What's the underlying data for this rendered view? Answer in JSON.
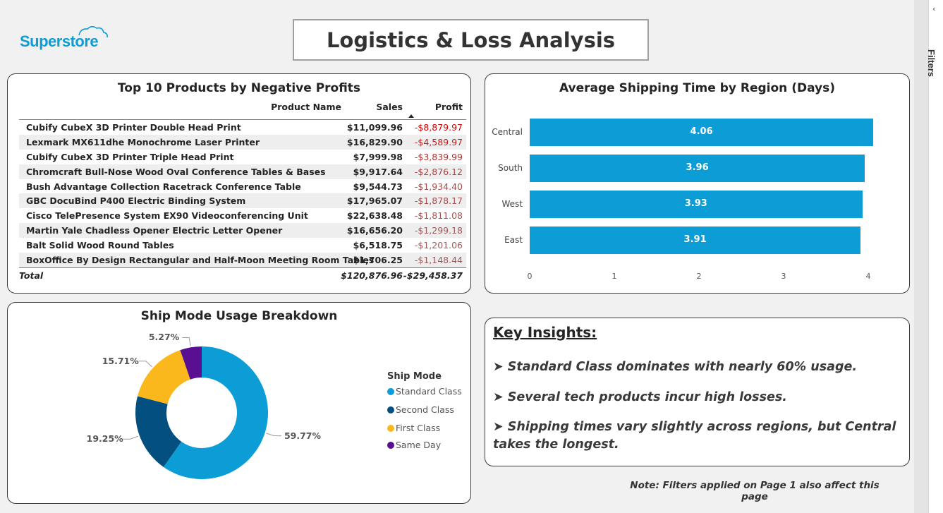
{
  "brand": {
    "logo_text": "Superstore"
  },
  "page": {
    "title": "Logistics & Loss Analysis"
  },
  "filters_pane": {
    "label": "Filters",
    "collapse_icon": "chevron-left-icon"
  },
  "products_table": {
    "title": "Top 10 Products by Negative Profits",
    "columns": [
      "Product Name",
      "Sales",
      "Profit"
    ],
    "sorted_column": "Profit",
    "rows": [
      {
        "name": "Cubify CubeX 3D Printer Double Head Print",
        "sales": "$11,099.96",
        "profit": "-$8,879.97"
      },
      {
        "name": "Lexmark MX611dhe Monochrome Laser Printer",
        "sales": "$16,829.90",
        "profit": "-$4,589.97"
      },
      {
        "name": "Cubify CubeX 3D Printer Triple Head Print",
        "sales": "$7,999.98",
        "profit": "-$3,839.99"
      },
      {
        "name": "Chromcraft Bull-Nose Wood Oval Conference Tables & Bases",
        "sales": "$9,917.64",
        "profit": "-$2,876.12"
      },
      {
        "name": "Bush Advantage Collection Racetrack Conference Table",
        "sales": "$9,544.73",
        "profit": "-$1,934.40"
      },
      {
        "name": "GBC DocuBind P400 Electric Binding System",
        "sales": "$17,965.07",
        "profit": "-$1,878.17"
      },
      {
        "name": "Cisco TelePresence System EX90 Videoconferencing Unit",
        "sales": "$22,638.48",
        "profit": "-$1,811.08"
      },
      {
        "name": "Martin Yale Chadless Opener Electric Letter Opener",
        "sales": "$16,656.20",
        "profit": "-$1,299.18"
      },
      {
        "name": "Balt Solid Wood Round Tables",
        "sales": "$6,518.75",
        "profit": "-$1,201.06"
      },
      {
        "name": "BoxOffice By Design Rectangular and Half-Moon Meeting Room Tables",
        "sales": "$1,706.25",
        "profit": "-$1,148.44"
      }
    ],
    "profit_colors": [
      "#d40000",
      "#c01e1e",
      "#b23232",
      "#a94444",
      "#a44d4d",
      "#a24f4f",
      "#a05252",
      "#9c5858",
      "#9a5a5a",
      "#995c5c"
    ],
    "total": {
      "label": "Total",
      "sales": "$120,876.96",
      "profit": "-$29,458.37"
    }
  },
  "chart_data": [
    {
      "type": "bar",
      "orientation": "horizontal",
      "title": "Average Shipping Time by Region (Days)",
      "categories": [
        "Central",
        "South",
        "West",
        "East"
      ],
      "values": [
        4.06,
        3.96,
        3.93,
        3.91
      ],
      "data_labels": [
        "4.06",
        "3.96",
        "3.93",
        "3.91"
      ],
      "xlim": [
        0,
        4
      ],
      "x_ticks": [
        "0",
        "1",
        "2",
        "3",
        "4"
      ],
      "grid": false,
      "color": "#0c9dd6"
    },
    {
      "type": "pie",
      "variant": "donut",
      "title": "Ship Mode Usage Breakdown",
      "legend_title": "Ship Mode",
      "legend_position": "right",
      "categories": [
        "Standard Class",
        "Second Class",
        "First Class",
        "Same Day"
      ],
      "values": [
        59.77,
        19.25,
        15.71,
        5.27
      ],
      "labels": [
        "59.77%",
        "19.25%",
        "15.71%",
        "5.27%"
      ],
      "colors": [
        "#0c9dd6",
        "#034f7f",
        "#fbb81c",
        "#5a0e91"
      ]
    }
  ],
  "insights": {
    "heading": "Key Insights:",
    "items": [
      "➤ Standard Class dominates with nearly 60% usage.",
      "➤ Several tech products incur high losses.",
      "➤ Shipping times vary slightly across regions, but Central takes the longest."
    ]
  },
  "footer_note": "Note: Filters applied on Page 1 also affect this page"
}
